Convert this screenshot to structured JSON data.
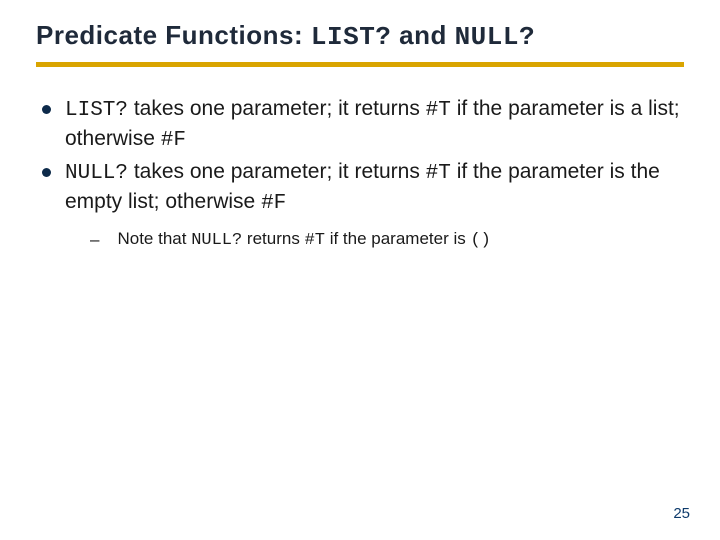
{
  "title": {
    "prefix": "Predicate Functions: ",
    "code1": "LIST?",
    "mid": " and ",
    "code2": "NULL?"
  },
  "bullets": [
    {
      "c1": "LIST?",
      "t1": " takes one parameter; it returns ",
      "c2": "#T",
      "t2": " if the parameter is a list; otherwise ",
      "c3": "#F"
    },
    {
      "c1": "NULL?",
      "t1": " takes one parameter; it returns ",
      "c2": "#T",
      "t2": " if the parameter is the empty list; otherwise  ",
      "c3": "#F"
    }
  ],
  "sub": {
    "t1": "Note that ",
    "c1": "NULL?",
    "t2": " returns ",
    "c2": "#T",
    "t3": " if the parameter is ",
    "c3": "()"
  },
  "page": "25"
}
